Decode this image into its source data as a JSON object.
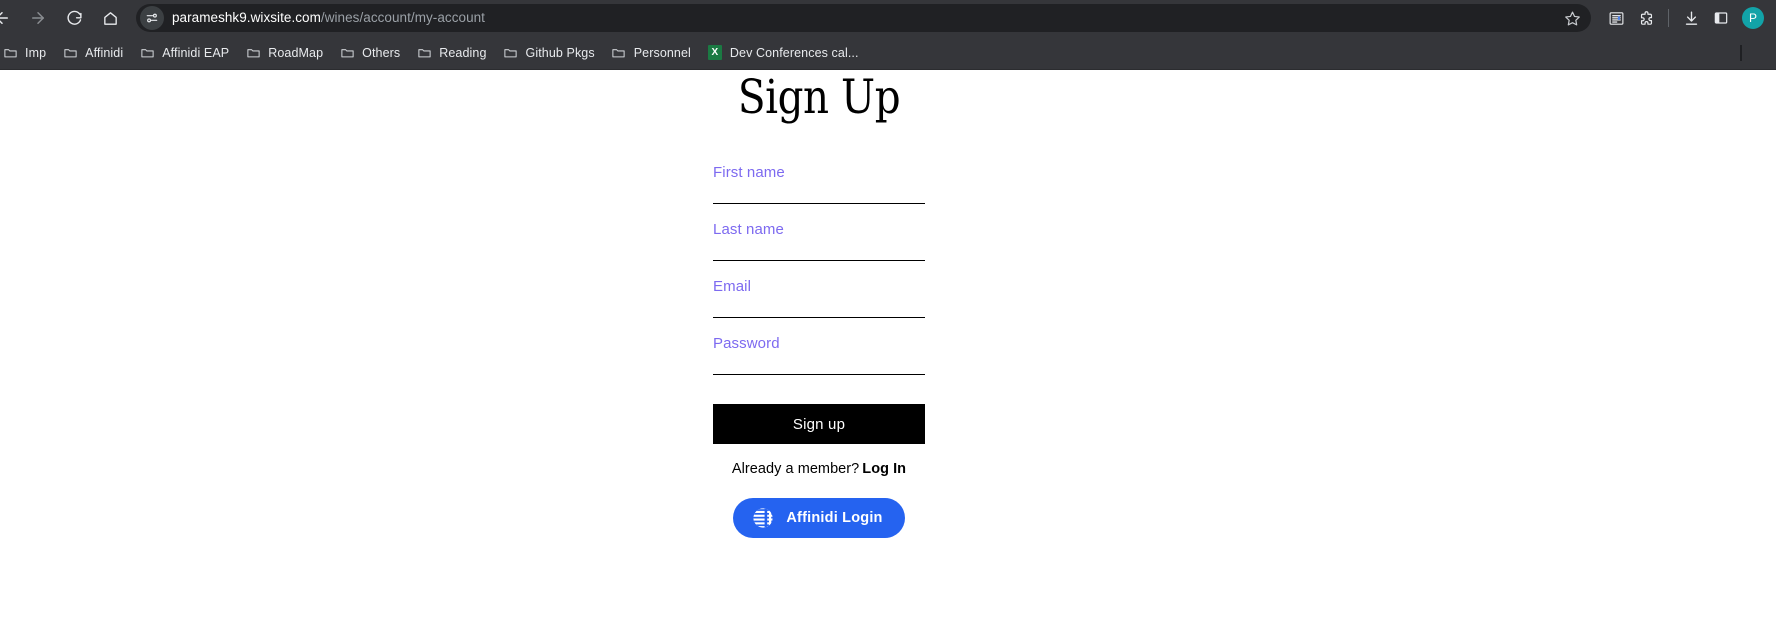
{
  "browser": {
    "nav": {
      "back_label": "Back",
      "forward_label": "Forward",
      "reload_label": "Reload",
      "home_label": "Home"
    },
    "address_bar": {
      "site_settings_label": "View site information",
      "url_host": "parameshk9.wixsite.com",
      "url_path": "/wines/account/my-account",
      "bookmark_label": "Bookmark this tab"
    },
    "toolbar_right": {
      "reading_list_label": "Reading list",
      "extensions_label": "Extensions",
      "downloads_label": "Downloads",
      "side_panel_label": "Side panel",
      "profile_initial": "P"
    },
    "bookmarks": [
      {
        "label": "Imp",
        "icon": "folder-icon"
      },
      {
        "label": "Affinidi",
        "icon": "folder-icon"
      },
      {
        "label": "Affinidi EAP",
        "icon": "folder-icon"
      },
      {
        "label": "RoadMap",
        "icon": "folder-icon"
      },
      {
        "label": "Others",
        "icon": "folder-icon"
      },
      {
        "label": "Reading",
        "icon": "folder-icon"
      },
      {
        "label": "Github Pkgs",
        "icon": "folder-icon"
      },
      {
        "label": "Personnel",
        "icon": "folder-icon"
      },
      {
        "label": "Dev Conferences cal...",
        "icon": "excel-icon",
        "icon_text": "X"
      }
    ]
  },
  "page": {
    "title": "Sign Up",
    "fields": [
      {
        "name": "first-name",
        "placeholder": "First name",
        "value": ""
      },
      {
        "name": "last-name",
        "placeholder": "Last name",
        "value": ""
      },
      {
        "name": "email",
        "placeholder": "Email",
        "value": ""
      },
      {
        "name": "password",
        "placeholder": "Password",
        "value": ""
      }
    ],
    "submit_label": "Sign up",
    "member_prompt": "Already a member?",
    "login_link": "Log In",
    "affinidi_label": "Affinidi Login",
    "colors": {
      "placeholder": "#7d6af0",
      "submit_bg": "#000000",
      "affinidi_bg": "#2563f0"
    }
  }
}
